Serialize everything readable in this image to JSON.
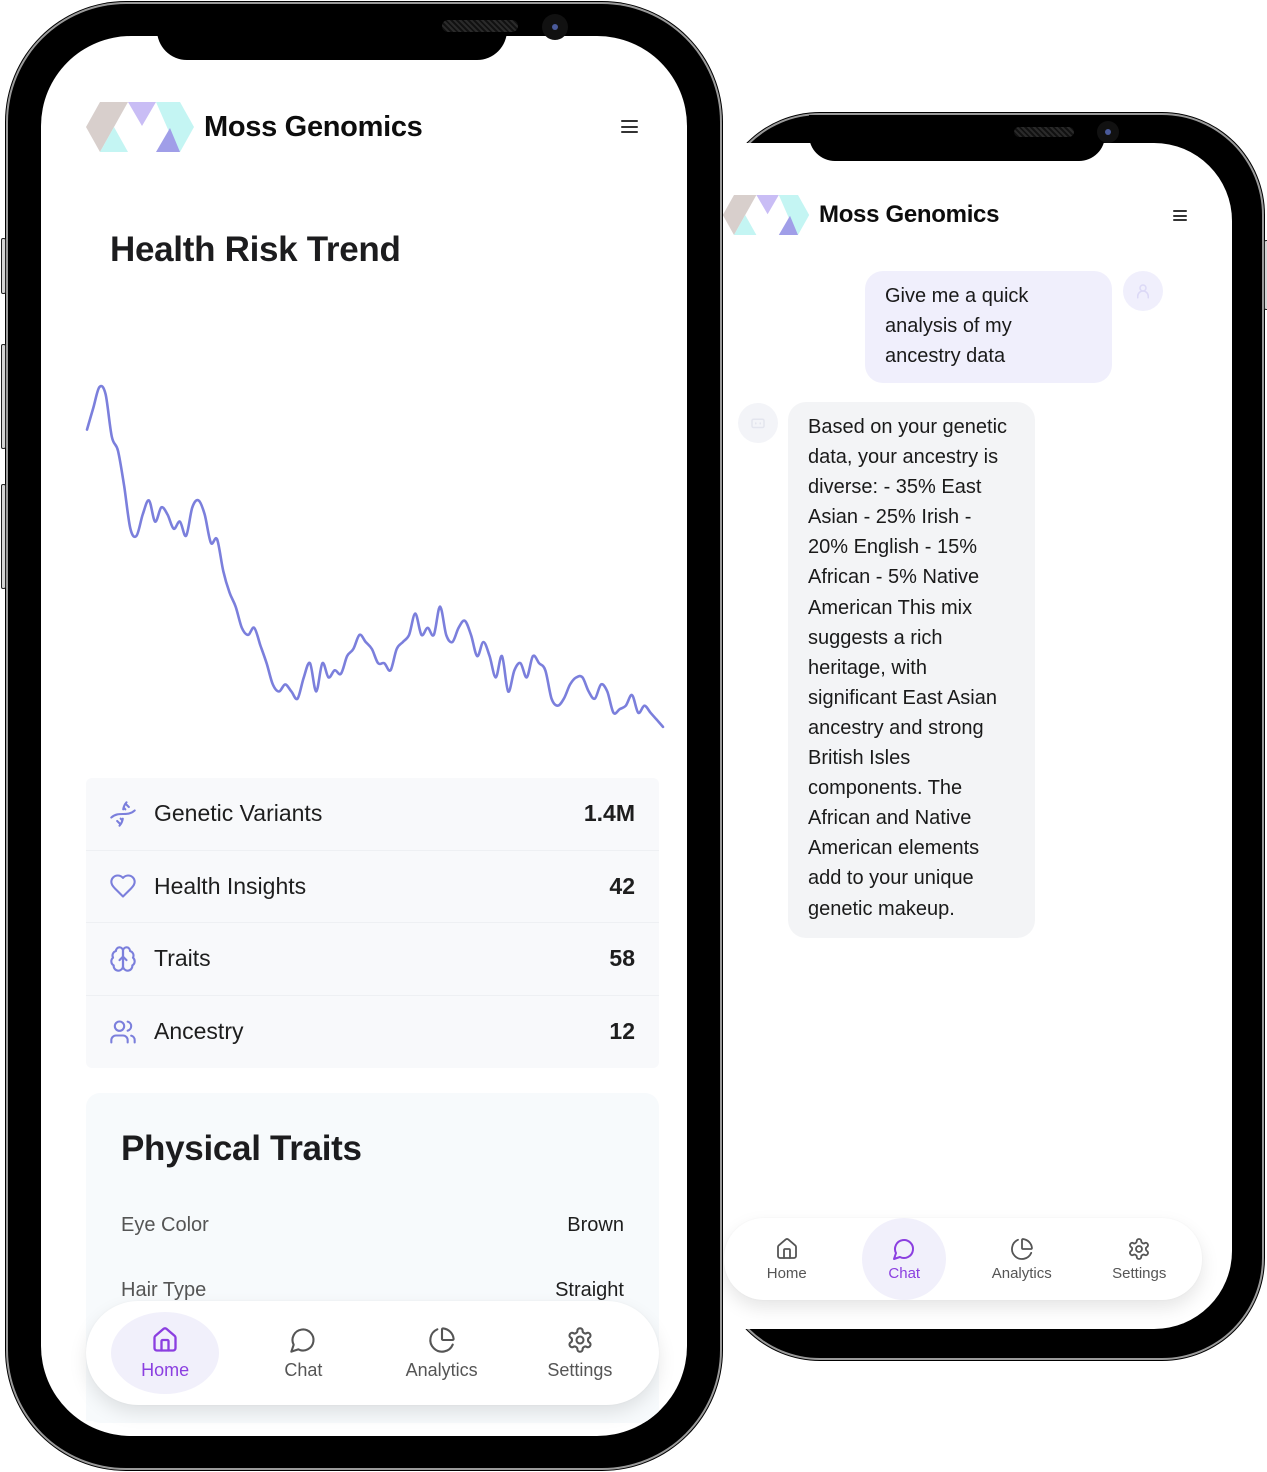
{
  "brand": {
    "name": "Moss Genomics",
    "colors": {
      "accent": "#8b3fe0",
      "chart_line": "#7b7fdc",
      "icon": "#7b7fdc",
      "logo_gray": "#d8cfcc",
      "logo_cyan": "#c4f5f3",
      "logo_lavender": "#c9bdf5",
      "logo_violet": "#a09ee8"
    }
  },
  "home_screen": {
    "header": {
      "title": "Moss Genomics",
      "menu_icon": "hamburger-icon"
    },
    "chart_section": {
      "title": "Health Risk Trend"
    },
    "stats": [
      {
        "icon": "dna-icon",
        "label": "Genetic Variants",
        "value": "1.4M"
      },
      {
        "icon": "heart-icon",
        "label": "Health Insights",
        "value": "42"
      },
      {
        "icon": "brain-icon",
        "label": "Traits",
        "value": "58"
      },
      {
        "icon": "users-icon",
        "label": "Ancestry",
        "value": "12"
      }
    ],
    "physical_traits": {
      "title": "Physical Traits",
      "rows": [
        {
          "label": "Eye Color",
          "value": "Brown"
        },
        {
          "label": "Hair Type",
          "value": "Straight"
        }
      ]
    },
    "bottom_nav": {
      "active": "Home",
      "items": [
        {
          "icon": "home-icon",
          "label": "Home"
        },
        {
          "icon": "chat-icon",
          "label": "Chat"
        },
        {
          "icon": "pie-chart-icon",
          "label": "Analytics"
        },
        {
          "icon": "gear-icon",
          "label": "Settings"
        }
      ]
    }
  },
  "chat_screen": {
    "header": {
      "title": "Moss Genomics",
      "menu_icon": "hamburger-icon"
    },
    "messages": [
      {
        "role": "user",
        "text": "Give me a quick analysis of my ancestry data"
      },
      {
        "role": "assistant",
        "text": "Based on your genetic data, your ancestry is diverse: - 35% East Asian - 25% Irish - 20% English - 15% African - 5% Native American This mix suggests a rich heritage, with significant East Asian ancestry and strong British Isles components. The African and Native American elements add to your unique genetic makeup."
      }
    ],
    "bottom_nav": {
      "active": "Chat",
      "items": [
        {
          "icon": "home-icon",
          "label": "Home"
        },
        {
          "icon": "chat-icon",
          "label": "Chat"
        },
        {
          "icon": "pie-chart-icon",
          "label": "Analytics"
        },
        {
          "icon": "gear-icon",
          "label": "Settings"
        }
      ]
    }
  },
  "chart_data": {
    "type": "line",
    "title": "Health Risk Trend",
    "xlabel": "",
    "ylabel": "",
    "grid": false,
    "axes_visible": false,
    "ylim": [
      0,
      100
    ],
    "series": [
      {
        "name": "Health Risk",
        "values": [
          86,
          92,
          98,
          96,
          84,
          80,
          70,
          58,
          56,
          62,
          66,
          60,
          64,
          62,
          58,
          60,
          56,
          64,
          66,
          62,
          54,
          55,
          46,
          40,
          36,
          30,
          28,
          30,
          25,
          20,
          14,
          12,
          14,
          12,
          10,
          16,
          20,
          12,
          20,
          16,
          18,
          17,
          22,
          24,
          28,
          26,
          24,
          20,
          20,
          18,
          24,
          26,
          28,
          34,
          28,
          30,
          28,
          36,
          28,
          26,
          30,
          32,
          28,
          22,
          26,
          22,
          16,
          22,
          12,
          18,
          20,
          16,
          22,
          20,
          18,
          10,
          8,
          10,
          14,
          16,
          16,
          12,
          10,
          14,
          12,
          6,
          7,
          8,
          11,
          6,
          8,
          6,
          4,
          2
        ]
      }
    ]
  }
}
